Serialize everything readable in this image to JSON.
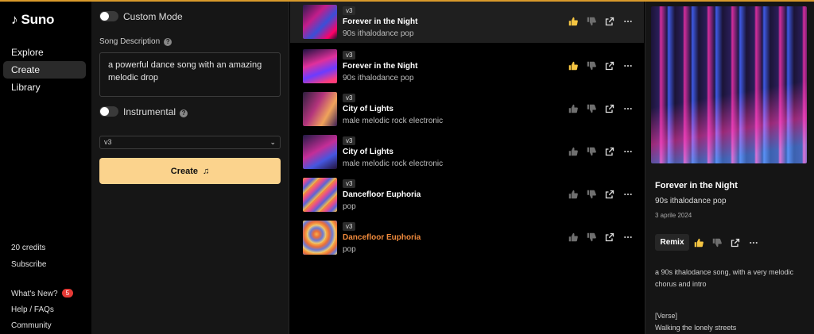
{
  "sidebar": {
    "logo_text": "Suno",
    "nav": [
      "Explore",
      "Create",
      "Library"
    ],
    "credits": "20 credits",
    "subscribe": "Subscribe",
    "whats_new": "What's New?",
    "whats_new_count": "5",
    "help": "Help / FAQs",
    "community": "Community"
  },
  "create": {
    "custom_mode": "Custom Mode",
    "song_description_label": "Song Description",
    "song_description": "a powerful dance song with an amazing melodic drop",
    "instrumental": "Instrumental",
    "model": "v3",
    "create_button": "Create"
  },
  "songs": [
    {
      "version": "v3",
      "title": "Forever in the Night",
      "style": "90s ithalodance pop"
    },
    {
      "version": "v3",
      "title": "Forever in the Night",
      "style": "90s ithalodance pop"
    },
    {
      "version": "v3",
      "title": "City of Lights",
      "style": "male melodic rock electronic"
    },
    {
      "version": "v3",
      "title": "City of Lights",
      "style": "male melodic rock electronic"
    },
    {
      "version": "v3",
      "title": "Dancefloor Euphoria",
      "style": "pop"
    },
    {
      "version": "v3",
      "title": "Dancefloor Euphoria",
      "style": "pop"
    }
  ],
  "detail": {
    "title": "Forever in the Night",
    "style": "90s ithalodance pop",
    "date": "3 aprile 2024",
    "remix": "Remix",
    "prompt": "a 90s ithalodance song, with a very melodic chorus and intro",
    "lyric_tag": "[Verse]",
    "lyric_line": "Walking the lonely streets"
  },
  "colors": {
    "accent_button": "#fbd38d",
    "playing_title": "#f08a3c",
    "liked_icon": "#f5c542",
    "top_line": "#d99a2b",
    "badge": "#e53935"
  }
}
